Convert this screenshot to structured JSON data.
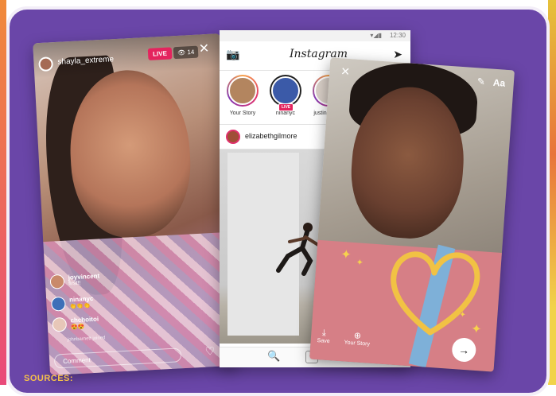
{
  "footer": {
    "sources_label": "SOURCES:"
  },
  "live_phone": {
    "username": "shayla_extreme",
    "live_badge": "LIVE",
    "viewer_count": "14",
    "comments": [
      {
        "name": "joyvincent",
        "text": "first!!"
      },
      {
        "name": "ninanyc",
        "text": "👏👏👏"
      },
      {
        "name": "chchoitoi",
        "text": "😍😍"
      }
    ],
    "joined_text": "johnbarnett joined",
    "comment_placeholder": "Comment"
  },
  "feed_phone": {
    "status_time": "12:30",
    "app_title": "Instagram",
    "stories": [
      {
        "label": "Your Story"
      },
      {
        "label": "ninanyc",
        "badge": "LIVE"
      },
      {
        "label": "justinagullar"
      }
    ],
    "post_username": "elizabethgilmore"
  },
  "story_phone": {
    "tool_text": "Aa",
    "save_label": "Save",
    "your_story_label": "Your Story"
  }
}
